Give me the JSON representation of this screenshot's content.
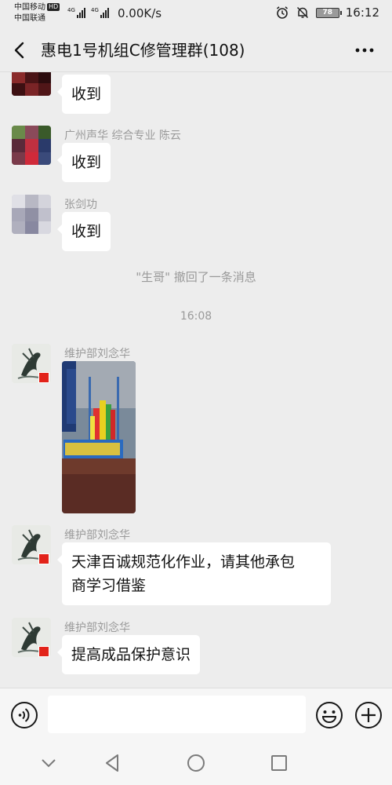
{
  "status_bar": {
    "carrier_1": "中国移动",
    "carrier_1_badge": "HD",
    "carrier_2": "中国联通",
    "net_1": "4G",
    "net_2": "4G",
    "speed": "0.00K/s",
    "battery": "78",
    "time": "16:12"
  },
  "header": {
    "title": "惠电1号机组C修管理群(108)"
  },
  "messages": [
    {
      "text": "收到"
    },
    {
      "sender": "广州声华  综合专业  陈云",
      "text": "收到"
    },
    {
      "sender": "张剑功",
      "text": "收到"
    }
  ],
  "system_note": "\"生哥\" 撤回了一条消息",
  "timestamp": "16:08",
  "later_messages": [
    {
      "sender": "维护部刘念华",
      "type": "image"
    },
    {
      "sender": "维护部刘念华",
      "text_line_1": "天津百诚规范化作业，请其他承包",
      "text_line_2": "商学习借鉴"
    },
    {
      "sender": "维护部刘念华",
      "text": "提高成品保护意识"
    }
  ],
  "input_bar": {
    "voice_icon": "voice-icon",
    "emoji_icon": "emoji-icon",
    "plus_icon": "plus-icon",
    "placeholder": ""
  },
  "colors": {
    "background": "#ededed",
    "bubble": "#ffffff",
    "meta_text": "#9a9a9a"
  }
}
